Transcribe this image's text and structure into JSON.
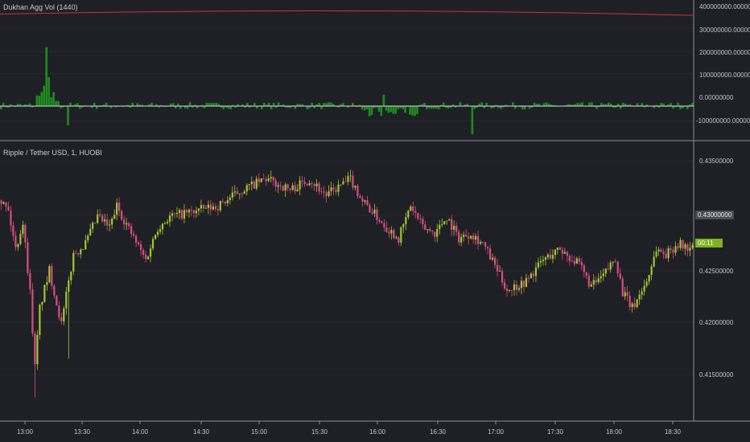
{
  "colors": {
    "background": "#1e2026",
    "grid": "#262830",
    "separator": "#8c9097",
    "up": "#a6c431",
    "down": "#d94c83",
    "vol_bar": "#1f8c1f",
    "vol_line": "#cc3333",
    "zero_line": "#d8dbe0",
    "current_tag": "#7fb21c",
    "last_tag": "#4a4d55"
  },
  "chart_data": [
    {
      "type": "bar",
      "title": "Dukhan Agg Vol (1440)",
      "yticks": [
        "400000000.00000000",
        "300000000.00000000",
        "200000000.00000000",
        "100000000.00000000",
        "0.00000000",
        "-100000000.00000000"
      ],
      "ylim": [
        -135000000,
        415000000
      ],
      "line_series": {
        "name": "",
        "start": 360000000,
        "mid": 375000000,
        "end": 355000000
      },
      "spike_values": [
        230000000,
        120000000,
        60000000,
        -75000000,
        -110000000,
        45000000
      ]
    },
    {
      "type": "candlestick",
      "title": "Ripple / Tether USD, 1, HUOBI",
      "yticks": [
        "0.43500000",
        "0.43000000",
        "0.42500000",
        "0.42000000",
        "0.41500000"
      ],
      "ylim": [
        0.411,
        0.437
      ],
      "x_ticks": [
        "13:00",
        "13:30",
        "14:00",
        "14:30",
        "15:00",
        "15:30",
        "16:00",
        "16:30",
        "17:00",
        "17:30",
        "18:00",
        "18:30"
      ],
      "close_path": [
        [
          0,
          0.4315
        ],
        [
          3,
          0.4305
        ],
        [
          6,
          0.427
        ],
        [
          9,
          0.4295
        ],
        [
          12,
          0.423
        ],
        [
          14,
          0.416
        ],
        [
          16,
          0.4215
        ],
        [
          20,
          0.425
        ],
        [
          25,
          0.42
        ],
        [
          30,
          0.4265
        ],
        [
          35,
          0.4275
        ],
        [
          40,
          0.43
        ],
        [
          45,
          0.429
        ],
        [
          48,
          0.431
        ],
        [
          55,
          0.428
        ],
        [
          60,
          0.426
        ],
        [
          65,
          0.429
        ],
        [
          70,
          0.43
        ],
        [
          80,
          0.4305
        ],
        [
          90,
          0.431
        ],
        [
          100,
          0.4325
        ],
        [
          110,
          0.4335
        ],
        [
          120,
          0.4325
        ],
        [
          128,
          0.4335
        ],
        [
          135,
          0.432
        ],
        [
          145,
          0.4335
        ],
        [
          150,
          0.4315
        ],
        [
          160,
          0.429
        ],
        [
          165,
          0.428
        ],
        [
          170,
          0.431
        ],
        [
          175,
          0.429
        ],
        [
          180,
          0.4285
        ],
        [
          185,
          0.43
        ],
        [
          190,
          0.428
        ],
        [
          195,
          0.4285
        ],
        [
          200,
          0.4275
        ],
        [
          206,
          0.425
        ],
        [
          210,
          0.4232
        ],
        [
          218,
          0.424
        ],
        [
          225,
          0.426
        ],
        [
          232,
          0.427
        ],
        [
          240,
          0.4255
        ],
        [
          245,
          0.4235
        ],
        [
          250,
          0.4245
        ],
        [
          255,
          0.4262
        ],
        [
          258,
          0.423
        ],
        [
          262,
          0.4215
        ],
        [
          268,
          0.424
        ],
        [
          272,
          0.427
        ],
        [
          276,
          0.4265
        ],
        [
          281,
          0.4275
        ],
        [
          286,
          0.427
        ]
      ],
      "current_price_tag": "00:11",
      "last_price_tag": "0.43000000"
    }
  ]
}
